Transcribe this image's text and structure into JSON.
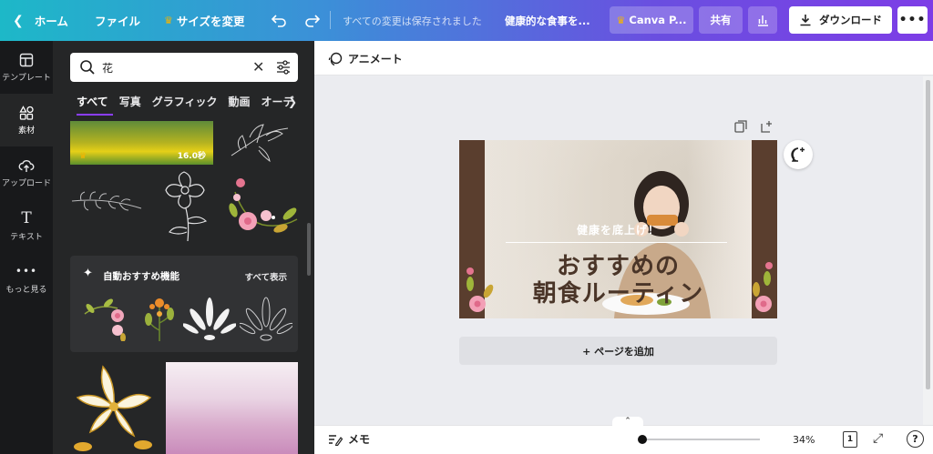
{
  "topbar": {
    "home": "ホーム",
    "file": "ファイル",
    "resize": "サイズを変更",
    "saved_status": "すべての変更は保存されました",
    "doc_title": "健康的な食事を...",
    "pro_label": "Canva P...",
    "share": "共有",
    "download": "ダウンロード"
  },
  "rail": {
    "items": [
      {
        "label": "テンプレート",
        "icon": "template-icon"
      },
      {
        "label": "素材",
        "icon": "elements-icon"
      },
      {
        "label": "アップロード",
        "icon": "upload-icon"
      },
      {
        "label": "テキスト",
        "icon": "text-icon"
      },
      {
        "label": "もっと見る",
        "icon": "more-icon"
      }
    ]
  },
  "panel": {
    "search_value": "花",
    "tabs": [
      "すべて",
      "写真",
      "グラフィック",
      "動画",
      "オーデ"
    ],
    "video_duration": "16.0秒",
    "recommend_title": "自動おすすめ機能",
    "recommend_all": "すべて表示"
  },
  "editor": {
    "animate": "アニメート",
    "design_subtitle": "健康を底上げ！",
    "design_title_line1": "おすすめの",
    "design_title_line2": "朝食ルーティン",
    "add_page": "+ ページを追加"
  },
  "bottombar": {
    "memo": "メモ",
    "zoom": "34%",
    "zoom_fraction": 0.34,
    "page_count": "1"
  },
  "colors": {
    "accent": "#8b3dff",
    "crown": "#f5b400",
    "panel_bg": "#252627",
    "rail_bg": "#18191b"
  }
}
